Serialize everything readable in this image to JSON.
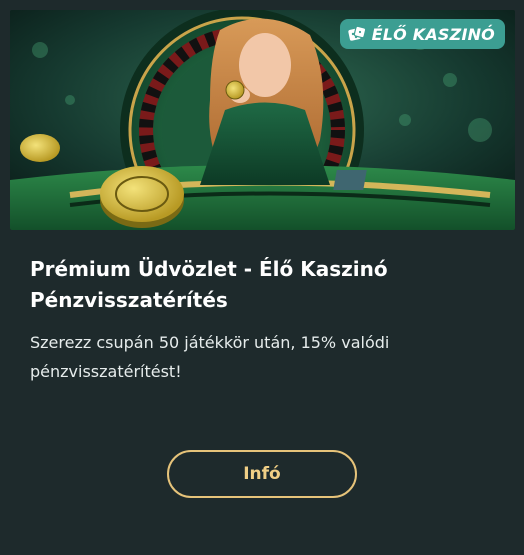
{
  "promo_card": {
    "badge": {
      "label": "ÉLŐ KASZINÓ",
      "icon": "dice-icon",
      "color": "#3c9e92"
    },
    "hero_image": {
      "subject": "live-casino-dealer-roulette"
    },
    "title": "Prémium Üdvözlet - Élő Kaszinó Pénzvisszatérítés",
    "description": "Szerezz csupán 50 játékkör után, 15% valódi pénzvisszatérítést!",
    "button": {
      "label": "Infó",
      "color": "#e6c37a"
    }
  },
  "colors": {
    "card_background": "#1e2a2c",
    "title_text": "#ffffff",
    "accent_gold": "#e6c37a"
  }
}
